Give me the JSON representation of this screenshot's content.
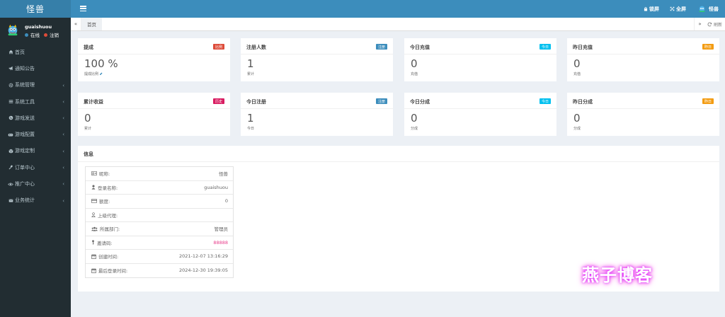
{
  "logo": "怪兽",
  "user": {
    "name": "guaishuou",
    "online_label": "在线",
    "logout_label": "注销"
  },
  "sidebar": {
    "items": [
      {
        "icon": "home-icon",
        "label": "首页",
        "has_submenu": false
      },
      {
        "icon": "bullhorn-icon",
        "label": "通知公告",
        "has_submenu": false
      },
      {
        "icon": "gear-icon",
        "label": "系统管理",
        "has_submenu": true
      },
      {
        "icon": "list-icon",
        "label": "系统工具",
        "has_submenu": true
      },
      {
        "icon": "globe-icon",
        "label": "游戏发送",
        "has_submenu": true
      },
      {
        "icon": "gamepad-icon",
        "label": "游戏配置",
        "has_submenu": true
      },
      {
        "icon": "cube-icon",
        "label": "游戏定制",
        "has_submenu": true
      },
      {
        "icon": "gavel-icon",
        "label": "订单中心",
        "has_submenu": true
      },
      {
        "icon": "eye-icon",
        "label": "推广中心",
        "has_submenu": true
      },
      {
        "icon": "envelope-icon",
        "label": "业务统计",
        "has_submenu": true
      }
    ]
  },
  "header": {
    "lock_label": "锁屏",
    "fullscreen_label": "全屏",
    "user_label": "怪兽"
  },
  "tabs": {
    "home": "首页",
    "refresh": "刷新"
  },
  "stats": [
    {
      "title": "提成",
      "badge": "比例",
      "badge_color": "#dd4b39",
      "value": "100 %",
      "sub": "提成比例"
    },
    {
      "title": "注册人数",
      "badge": "注册",
      "badge_color": "#3c8dbc",
      "value": "1",
      "sub": "累计"
    },
    {
      "title": "今日充值",
      "badge": "今日",
      "badge_color": "#00c0ef",
      "value": "0",
      "sub": "充值"
    },
    {
      "title": "昨日充值",
      "badge": "昨日",
      "badge_color": "#f39c12",
      "value": "0",
      "sub": "充值"
    },
    {
      "title": "累计收益",
      "badge": "历史",
      "badge_color": "#d81b60",
      "value": "0",
      "sub": "累计"
    },
    {
      "title": "今日注册",
      "badge": "注册",
      "badge_color": "#3c8dbc",
      "value": "1",
      "sub": "今日"
    },
    {
      "title": "今日分成",
      "badge": "今日",
      "badge_color": "#00c0ef",
      "value": "0",
      "sub": "分成"
    },
    {
      "title": "昨日分成",
      "badge": "昨日",
      "badge_color": "#f39c12",
      "value": "0",
      "sub": "分成"
    }
  ],
  "info": {
    "title": "信息",
    "rows": [
      {
        "icon": "id-card-icon",
        "label": "昵称:",
        "value": "怪兽",
        "value_color": "#666666"
      },
      {
        "icon": "user-icon",
        "label": "登录名称:",
        "value": "guaishuou",
        "value_color": "#666666"
      },
      {
        "icon": "credit-card-icon",
        "label": "额度:",
        "value": "0",
        "value_color": "#666666"
      },
      {
        "icon": "user-outline-icon",
        "label": "上级代理:",
        "value": "",
        "value_color": "#666666"
      },
      {
        "icon": "users-icon",
        "label": "所属部门:",
        "value": "管理员",
        "value_color": "#666666"
      },
      {
        "icon": "key-icon",
        "label": "邀请码:",
        "value": "88888",
        "value_color": "#e83e8c"
      },
      {
        "icon": "calendar-icon",
        "label": "创建时间:",
        "value": "2021-12-07 13:16:29",
        "value_color": "#666666"
      },
      {
        "icon": "calendar-icon",
        "label": "最后登录时间:",
        "value": "2024-12-30 19:39:05",
        "value_color": "#666666"
      }
    ]
  },
  "watermark": "燕子博客"
}
